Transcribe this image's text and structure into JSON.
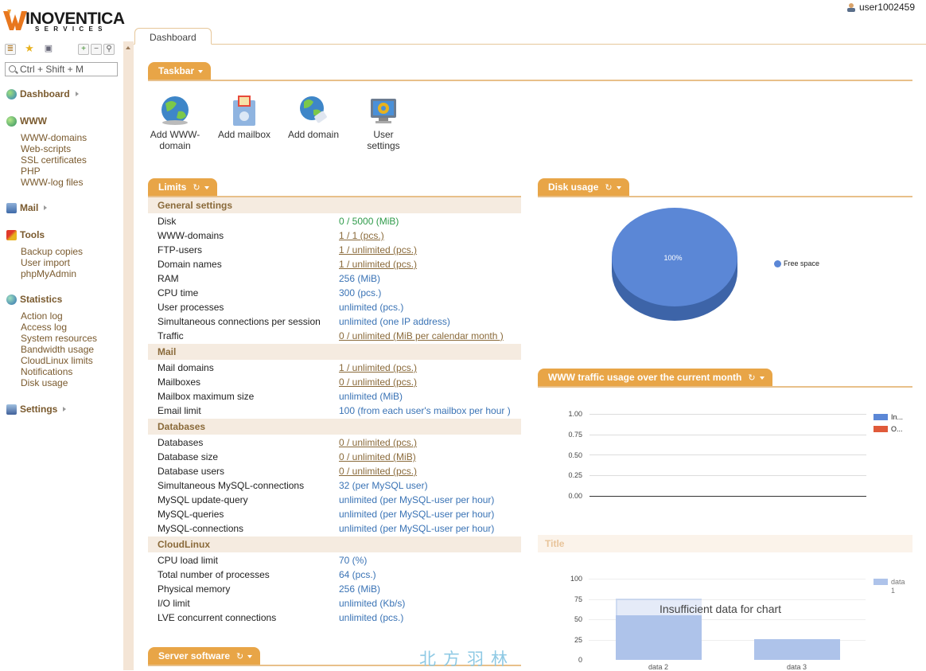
{
  "brand": {
    "name": "INOVENTICA",
    "subtitle": "SERVICES"
  },
  "user": {
    "name": "user1002459"
  },
  "sidebar": {
    "search_placeholder": "Ctrl + Shift + M",
    "groups": [
      {
        "label": "Dashboard",
        "icon": "globe-icon",
        "items": []
      },
      {
        "label": "WWW",
        "icon": "www-icon",
        "items": [
          "WWW-domains",
          "Web-scripts",
          "SSL certificates",
          "PHP",
          "WWW-log files"
        ]
      },
      {
        "label": "Mail",
        "icon": "mail-icon",
        "items": []
      },
      {
        "label": "Tools",
        "icon": "tools-icon",
        "items": [
          "Backup copies",
          "User import",
          "phpMyAdmin"
        ]
      },
      {
        "label": "Statistics",
        "icon": "stats-icon",
        "items": [
          "Action log",
          "Access log",
          "System resources",
          "Bandwidth usage",
          "CloudLinux limits",
          "Notifications",
          "Disk usage"
        ]
      },
      {
        "label": "Settings",
        "icon": "settings-icon",
        "items": []
      }
    ]
  },
  "tabs": {
    "dashboard": "Dashboard"
  },
  "taskbar": {
    "title": "Taskbar",
    "items": [
      {
        "label": "Add WWW-domain",
        "icon": "www-globe-icon"
      },
      {
        "label": "Add mailbox",
        "icon": "mailbox-icon"
      },
      {
        "label": "Add domain",
        "icon": "domain-globe-icon"
      },
      {
        "label": "User settings",
        "icon": "user-settings-icon"
      }
    ]
  },
  "limits": {
    "title": "Limits",
    "sections": [
      {
        "title": "General settings",
        "rows": [
          {
            "k": "Disk",
            "v": "0 / 5000 (MiB)",
            "style": "g"
          },
          {
            "k": "WWW-domains",
            "v": "1 / 1 (pcs.)",
            "style": "u"
          },
          {
            "k": "FTP-users",
            "v": "1 / unlimited (pcs.)",
            "style": "u"
          },
          {
            "k": "Domain names",
            "v": "1 / unlimited (pcs.)",
            "style": "u"
          },
          {
            "k": "RAM",
            "v": "256 (MiB)",
            "style": ""
          },
          {
            "k": "CPU time",
            "v": "300 (pcs.)",
            "style": ""
          },
          {
            "k": "User processes",
            "v": "unlimited (pcs.)",
            "style": ""
          },
          {
            "k": "Simultaneous connections per session",
            "v": "unlimited (one IP address)",
            "style": ""
          },
          {
            "k": "Traffic",
            "v": "0 / unlimited (MiB per calendar month )",
            "style": "u"
          }
        ]
      },
      {
        "title": "Mail",
        "rows": [
          {
            "k": "Mail domains",
            "v": "1 / unlimited (pcs.)",
            "style": "u"
          },
          {
            "k": "Mailboxes",
            "v": "0 / unlimited (pcs.)",
            "style": "u"
          },
          {
            "k": "Mailbox maximum size",
            "v": "unlimited (MiB)",
            "style": ""
          },
          {
            "k": "Email limit",
            "v": "100 (from each user's mailbox per hour )",
            "style": ""
          }
        ]
      },
      {
        "title": "Databases",
        "rows": [
          {
            "k": "Databases",
            "v": "0 / unlimited (pcs.)",
            "style": "u"
          },
          {
            "k": "Database size",
            "v": "0 / unlimited (MiB)",
            "style": "u"
          },
          {
            "k": "Database users",
            "v": "0 / unlimited (pcs.)",
            "style": "u"
          },
          {
            "k": "Simultaneous MySQL-connections",
            "v": "32 (per MySQL user)",
            "style": ""
          },
          {
            "k": "MySQL update-query",
            "v": "unlimited (per MySQL-user per hour)",
            "style": ""
          },
          {
            "k": "MySQL-queries",
            "v": "unlimited (per MySQL-user per hour)",
            "style": ""
          },
          {
            "k": "MySQL-connections",
            "v": "unlimited (per MySQL-user per hour)",
            "style": ""
          }
        ]
      },
      {
        "title": "CloudLinux",
        "rows": [
          {
            "k": "CPU load limit",
            "v": "70 (%)",
            "style": ""
          },
          {
            "k": "Total number of processes",
            "v": "64 (pcs.)",
            "style": ""
          },
          {
            "k": "Physical memory",
            "v": "256 (MiB)",
            "style": ""
          },
          {
            "k": "I/O limit",
            "v": "unlimited (Kb/s)",
            "style": ""
          },
          {
            "k": "LVE concurrent connections",
            "v": "unlimited (pcs.)",
            "style": ""
          }
        ]
      }
    ]
  },
  "server_software": {
    "title": "Server software"
  },
  "disk_usage": {
    "title": "Disk usage",
    "slice_label": "100%",
    "legend": "Free space"
  },
  "www_traffic": {
    "title": "WWW traffic usage over the current month",
    "legend": [
      "In...",
      "O..."
    ]
  },
  "title_panel": {
    "title": "Title",
    "message": "Insufficient data for chart",
    "legend": "data 1"
  },
  "watermark": "北方羽林",
  "colors": {
    "accent": "#e8a547",
    "blue": "#5b87d6",
    "red": "#e05a3a",
    "light_blue": "#aec3ea"
  },
  "chart_data": [
    {
      "type": "pie",
      "title": "Disk usage",
      "categories": [
        "Free space"
      ],
      "values": [
        100
      ],
      "labels": [
        "100%"
      ],
      "legend": "right"
    },
    {
      "type": "line",
      "title": "WWW traffic usage over the current month",
      "yticks": [
        "1.00",
        "0.75",
        "0.50",
        "0.25",
        "0.00"
      ],
      "ylim": [
        0,
        1
      ],
      "series": [
        {
          "name": "In...",
          "values": []
        },
        {
          "name": "O...",
          "values": []
        }
      ],
      "legend": "right"
    },
    {
      "type": "bar",
      "title": "Title",
      "categories": [
        "data 2",
        "data 3"
      ],
      "series": [
        {
          "name": "data 1",
          "values": [
            55,
            25
          ]
        }
      ],
      "yticks": [
        "100",
        "75",
        "50",
        "25",
        "0"
      ],
      "ylim": [
        0,
        100
      ],
      "legend": "right"
    }
  ]
}
